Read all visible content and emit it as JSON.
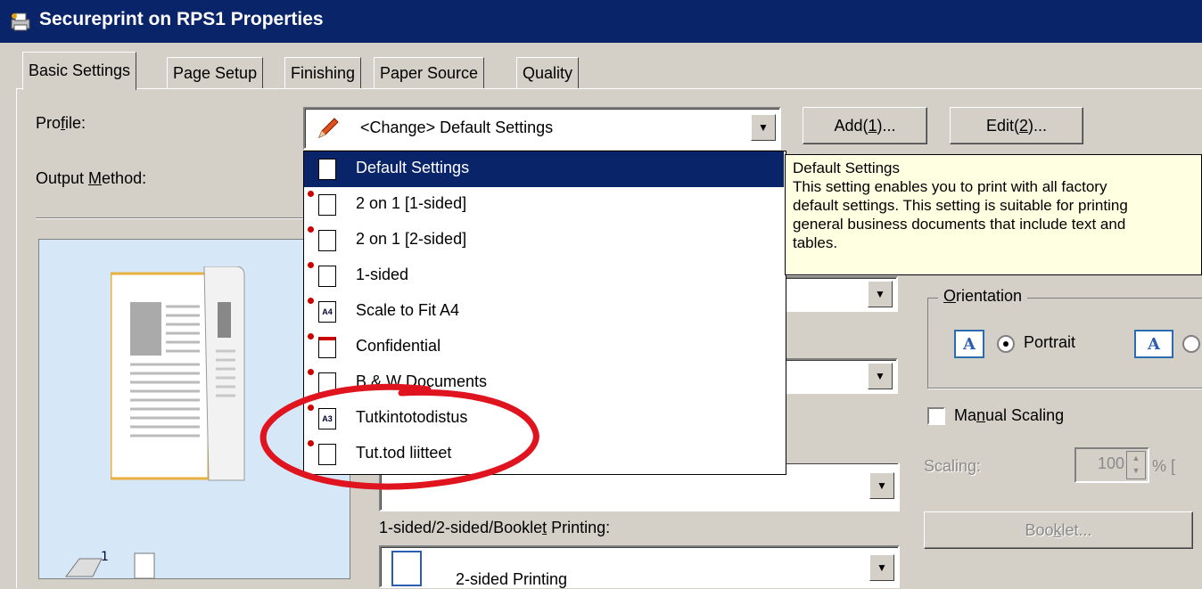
{
  "window": {
    "title": "Secureprint on RPS1 Properties",
    "icon": "printer-icon"
  },
  "tabs": [
    {
      "label": "Basic Settings",
      "active": true
    },
    {
      "label": "Page Setup"
    },
    {
      "label": "Finishing"
    },
    {
      "label": "Paper Source"
    },
    {
      "label": "Quality"
    }
  ],
  "profile": {
    "label_pre": "Pro",
    "label_u": "f",
    "label_post": "ile:",
    "value": "<Change> Default Settings",
    "add_pre": "Add(",
    "add_u": "1",
    "add_post": ")...",
    "edit_pre": "Edit(",
    "edit_u": "2",
    "edit_post": ")..."
  },
  "output_method": {
    "label_pre": "Output ",
    "label_u": "M",
    "label_post": "ethod:"
  },
  "profile_list": [
    {
      "label": "Default Settings",
      "icon": "page-icon",
      "selected": true
    },
    {
      "label": "2 on 1 [1-sided]",
      "icon": "2on1-icon"
    },
    {
      "label": "2 on 1 [2-sided]",
      "icon": "2on1-duplex-icon"
    },
    {
      "label": "1-sided",
      "icon": "1-sided-icon"
    },
    {
      "label": "Scale to Fit A4",
      "icon": "a4-icon",
      "badge": "A4"
    },
    {
      "label": "Confidential",
      "icon": "confidential-icon"
    },
    {
      "label": "B & W Documents",
      "icon": "bw-icon"
    },
    {
      "label": "Tutkintotodistus",
      "icon": "a3-icon",
      "badge": "A3"
    },
    {
      "label": "Tut.tod liitteet",
      "icon": "duplex-doc-icon"
    }
  ],
  "tooltip": {
    "title": "Default Settings",
    "lines": [
      "This setting enables you to print with all factory",
      "default settings. This setting is suitable for printing",
      "general business documents that include text and",
      "tables."
    ]
  },
  "orientation": {
    "label_u": "O",
    "label_post": "rientation",
    "portrait": "Portrait",
    "icon_letter": "A"
  },
  "manual_scaling": {
    "label_pre": "Ma",
    "label_u": "n",
    "label_post": "ual Scaling"
  },
  "scaling": {
    "label": "Scaling:",
    "value": "100",
    "unit": "% ["
  },
  "duplex": {
    "label_pre": "1-sided/2-sided/Bookle",
    "label_u": "t",
    "label_post": " Printing:",
    "value": "2-sided Printing",
    "booklet_pre": "Boo",
    "booklet_u": "k",
    "booklet_post": "let..."
  },
  "colors": {
    "titlebar": "#0a246a",
    "selection": "#0a246a",
    "annotation": "#e0141e",
    "tooltip": "#ffffe1"
  }
}
